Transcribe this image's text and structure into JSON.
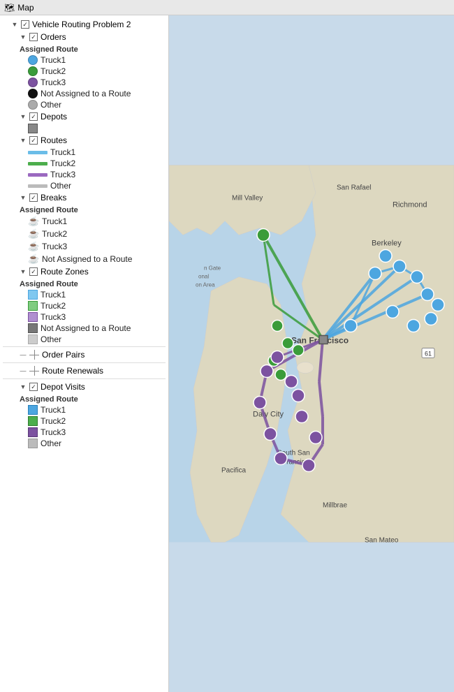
{
  "topbar": {
    "title": "Map"
  },
  "tree": {
    "root": "Vehicle Routing Problem 2",
    "sections": [
      {
        "id": "orders",
        "label": "Orders",
        "checked": true,
        "expanded": true,
        "sub_sections": [
          {
            "id": "orders-assigned-route",
            "label": "Assigned Route",
            "items": [
              {
                "id": "orders-truck1",
                "label": "Truck1",
                "color": "#4da6e0",
                "type": "circle"
              },
              {
                "id": "orders-truck2",
                "label": "Truck2",
                "color": "#4cae4c",
                "type": "circle"
              },
              {
                "id": "orders-truck3",
                "label": "Truck3",
                "color": "#7c52a0",
                "type": "circle"
              },
              {
                "id": "orders-not-assigned",
                "label": "Not Assigned to a Route",
                "color": "#111",
                "type": "circle-dark"
              },
              {
                "id": "orders-other",
                "label": "Other",
                "color": "#aaa",
                "type": "circle-gray"
              }
            ]
          }
        ]
      },
      {
        "id": "depots",
        "label": "Depots",
        "checked": true,
        "expanded": true,
        "items": [
          {
            "id": "depots-sym",
            "label": "",
            "color": "#888",
            "type": "square-gray"
          }
        ]
      },
      {
        "id": "routes",
        "label": "Routes",
        "checked": true,
        "expanded": true,
        "items": [
          {
            "id": "routes-truck1",
            "label": "Truck1",
            "color": "#4da6e0",
            "type": "line"
          },
          {
            "id": "routes-truck2",
            "label": "Truck2",
            "color": "#4cae4c",
            "type": "line"
          },
          {
            "id": "routes-truck3",
            "label": "Truck3",
            "color": "#7c52a0",
            "type": "line"
          },
          {
            "id": "routes-other",
            "label": "Other",
            "color": "#aaa",
            "type": "line"
          }
        ]
      },
      {
        "id": "breaks",
        "label": "Breaks",
        "checked": true,
        "expanded": true,
        "sub_sections": [
          {
            "id": "breaks-assigned-route",
            "label": "Assigned Route",
            "items": [
              {
                "id": "breaks-truck1",
                "label": "Truck1",
                "color": "#4da6e0",
                "type": "cup-blue"
              },
              {
                "id": "breaks-truck2",
                "label": "Truck2",
                "color": "#4cae4c",
                "type": "cup-green"
              },
              {
                "id": "breaks-truck3",
                "label": "Truck3",
                "color": "#7c52a0",
                "type": "cup-purple"
              },
              {
                "id": "breaks-not-assigned",
                "label": "Not Assigned to a Route",
                "color": "#111",
                "type": "cup-dark"
              }
            ]
          }
        ]
      },
      {
        "id": "route-zones",
        "label": "Route Zones",
        "checked": true,
        "expanded": true,
        "sub_sections": [
          {
            "id": "routezones-assigned-route",
            "label": "Assigned Route",
            "items": [
              {
                "id": "rz-truck1",
                "label": "Truck1",
                "color": "#80c8f0",
                "type": "square"
              },
              {
                "id": "rz-truck2",
                "label": "Truck2",
                "color": "#80cc80",
                "type": "square"
              },
              {
                "id": "rz-truck3",
                "label": "Truck3",
                "color": "#b090d0",
                "type": "square"
              },
              {
                "id": "rz-not-assigned",
                "label": "Not Assigned to a Route",
                "color": "#888",
                "type": "square-dark"
              },
              {
                "id": "rz-other",
                "label": "Other",
                "color": "#ccc",
                "type": "square-light"
              }
            ]
          }
        ]
      },
      {
        "id": "order-pairs",
        "label": "Order Pairs",
        "checked": false,
        "expanded": false,
        "has_grid": true
      },
      {
        "id": "route-renewals",
        "label": "Route Renewals",
        "checked": false,
        "expanded": false,
        "has_grid": true
      },
      {
        "id": "depot-visits",
        "label": "Depot Visits",
        "checked": true,
        "expanded": true,
        "sub_sections": [
          {
            "id": "depotvisits-assigned-route",
            "label": "Assigned Route",
            "items": [
              {
                "id": "dv-truck1",
                "label": "Truck1",
                "color": "#4da6e0",
                "type": "square"
              },
              {
                "id": "dv-truck2",
                "label": "Truck2",
                "color": "#4cae4c",
                "type": "square"
              },
              {
                "id": "dv-truck3",
                "label": "Truck3",
                "color": "#7c52a0",
                "type": "square"
              },
              {
                "id": "dv-other",
                "label": "Other",
                "color": "#aaa",
                "type": "square-light"
              }
            ]
          }
        ]
      }
    ]
  },
  "map": {
    "bg_water": "#b8d4e8",
    "bg_land": "#e8e0d0",
    "accent": "#c8daea"
  }
}
